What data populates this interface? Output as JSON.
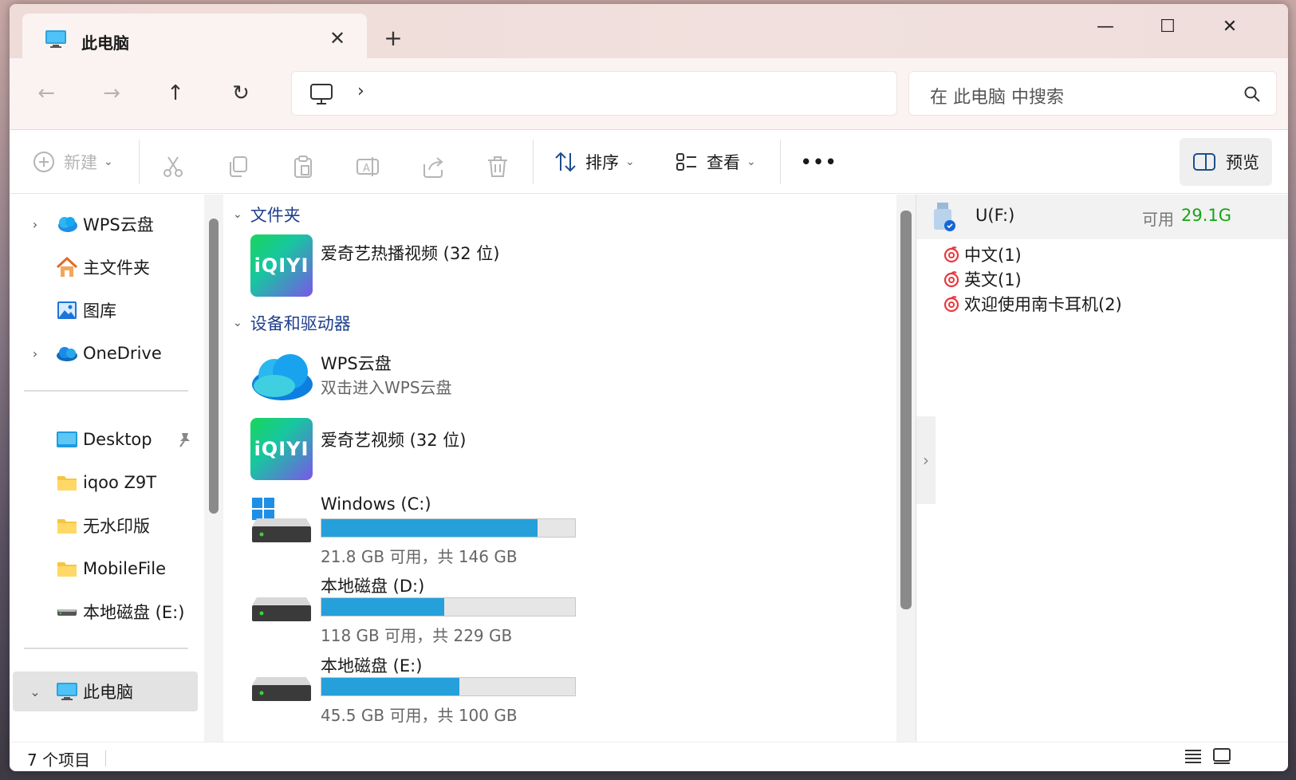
{
  "tab": {
    "title": "此电脑",
    "close": "✕",
    "new_tab": "+"
  },
  "window_controls": {
    "minimize": "—",
    "maximize": "☐",
    "close": "✕"
  },
  "nav": {
    "back": "←",
    "forward": "→",
    "up": "↑",
    "refresh": "↻",
    "breadcrumb_chevron": "›"
  },
  "search": {
    "placeholder": "在 此电脑 中搜索"
  },
  "toolbar": {
    "new_label": "新建",
    "sort_label": "排序",
    "view_label": "查看",
    "more_label": "•••",
    "preview_label": "预览"
  },
  "sidebar": {
    "items": [
      {
        "label": "WPS云盘",
        "icon": "cloud-icon",
        "expandable": true
      },
      {
        "label": "主文件夹",
        "icon": "home-icon",
        "expandable": false
      },
      {
        "label": "图库",
        "icon": "gallery-icon",
        "expandable": false
      },
      {
        "label": "OneDrive",
        "icon": "onedrive-icon",
        "expandable": true
      },
      {
        "label": "Desktop",
        "icon": "desktop-icon",
        "pinned": true
      },
      {
        "label": "iqoo Z9T",
        "icon": "folder-icon"
      },
      {
        "label": "无水印版",
        "icon": "folder-icon"
      },
      {
        "label": "MobileFile",
        "icon": "folder-icon"
      },
      {
        "label": "本地磁盘 (E:)",
        "icon": "drive-icon"
      },
      {
        "label": "此电脑",
        "icon": "this-pc-icon",
        "selected": true,
        "expanded": true
      }
    ]
  },
  "main": {
    "folders_header": "文件夹",
    "devices_header": "设备和驱动器",
    "folders": [
      {
        "name": "爱奇艺热播视频 (32 位)",
        "logo_text": "iQIYI"
      }
    ],
    "devices": [
      {
        "name": "WPS云盘",
        "sub": "双击进入WPS云盘"
      },
      {
        "name": "爱奇艺视频 (32 位)",
        "logo_text": "iQIYI"
      }
    ],
    "drives": [
      {
        "name": "Windows (C:)",
        "sub": "21.8 GB 可用，共 146 GB",
        "used_fraction": 0.851
      },
      {
        "name": "本地磁盘 (D:)",
        "sub": "118 GB 可用，共 229 GB",
        "used_fraction": 0.485
      },
      {
        "name": "本地磁盘 (E:)",
        "sub": "45.5 GB 可用，共 100 GB",
        "used_fraction": 0.545
      }
    ]
  },
  "preview": {
    "drive": "U(F:)",
    "avail_label": "可用",
    "avail_size": "29.1G",
    "files": [
      "中文(1)",
      "英文(1)",
      "欢迎使用南卡耳机(2)"
    ],
    "collapse": "›"
  },
  "status": {
    "count": "7 个项目"
  },
  "colors": {
    "accent": "#26a0da",
    "free_space": "#16a616",
    "group_header": "#1f3f8c",
    "selected": "#e3e3e3"
  }
}
